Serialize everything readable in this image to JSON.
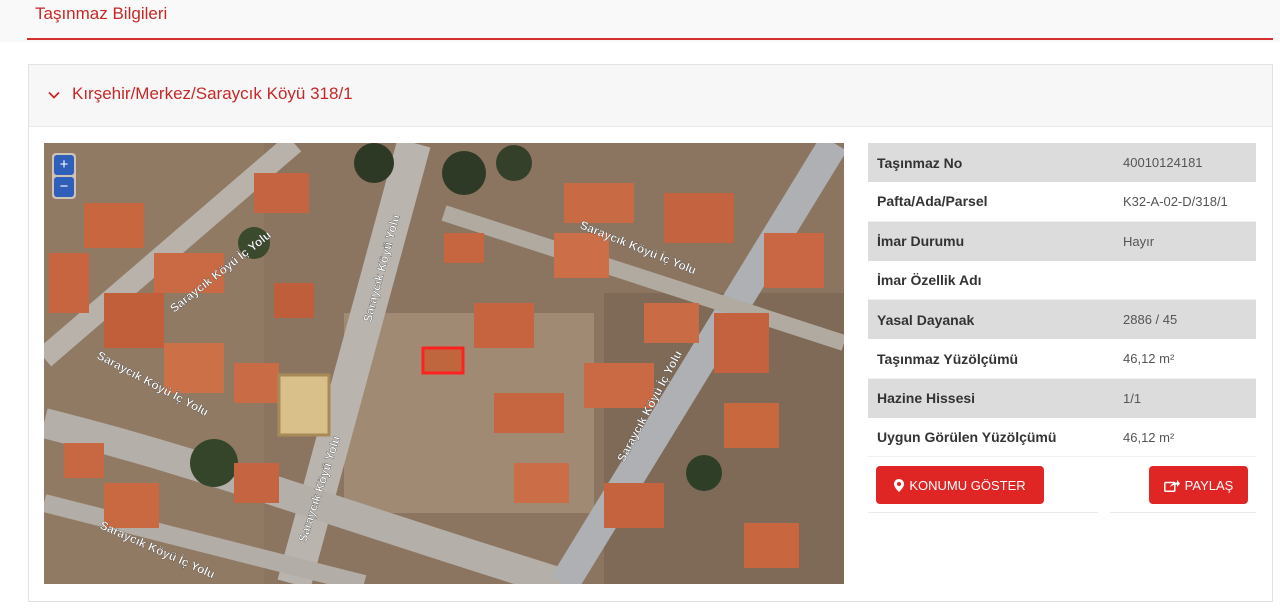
{
  "page": {
    "title": "Taşınmaz Bilgileri"
  },
  "panel": {
    "title": "Kırşehir/Merkez/Saraycık Köyü 318/1"
  },
  "map": {
    "zoom_in": "+",
    "zoom_out": "−",
    "street_labels": [
      "Saraycık Köyü İç Yolu",
      "Saraycık Köyü Yolu"
    ]
  },
  "property": [
    {
      "label": "Taşınmaz No",
      "value": "40010124181"
    },
    {
      "label": "Pafta/Ada/Parsel",
      "value": "K32-A-02-D/318/1"
    },
    {
      "label": "İmar Durumu",
      "value": "Hayır"
    },
    {
      "label": "İmar Özellik Adı",
      "value": ""
    },
    {
      "label": "Yasal Dayanak",
      "value": "2886 / 45"
    },
    {
      "label": "Taşınmaz Yüzölçümü",
      "value": "46,12 m²"
    },
    {
      "label": "Hazine Hissesi",
      "value": "1/1"
    },
    {
      "label": "Uygun Görülen Yüzölçümü",
      "value": "46,12 m²"
    }
  ],
  "actions": {
    "show_location": "KONUMU GÖSTER",
    "share": "PAYLAŞ"
  },
  "colors": {
    "accent": "#d32f2f",
    "button": "#e02525",
    "zoom": "#2f5fb8",
    "parcel_outline": "#ff2020"
  },
  "icons": {
    "chevron": "chevron-down-icon",
    "location": "map-marker-icon",
    "share": "share-icon"
  }
}
